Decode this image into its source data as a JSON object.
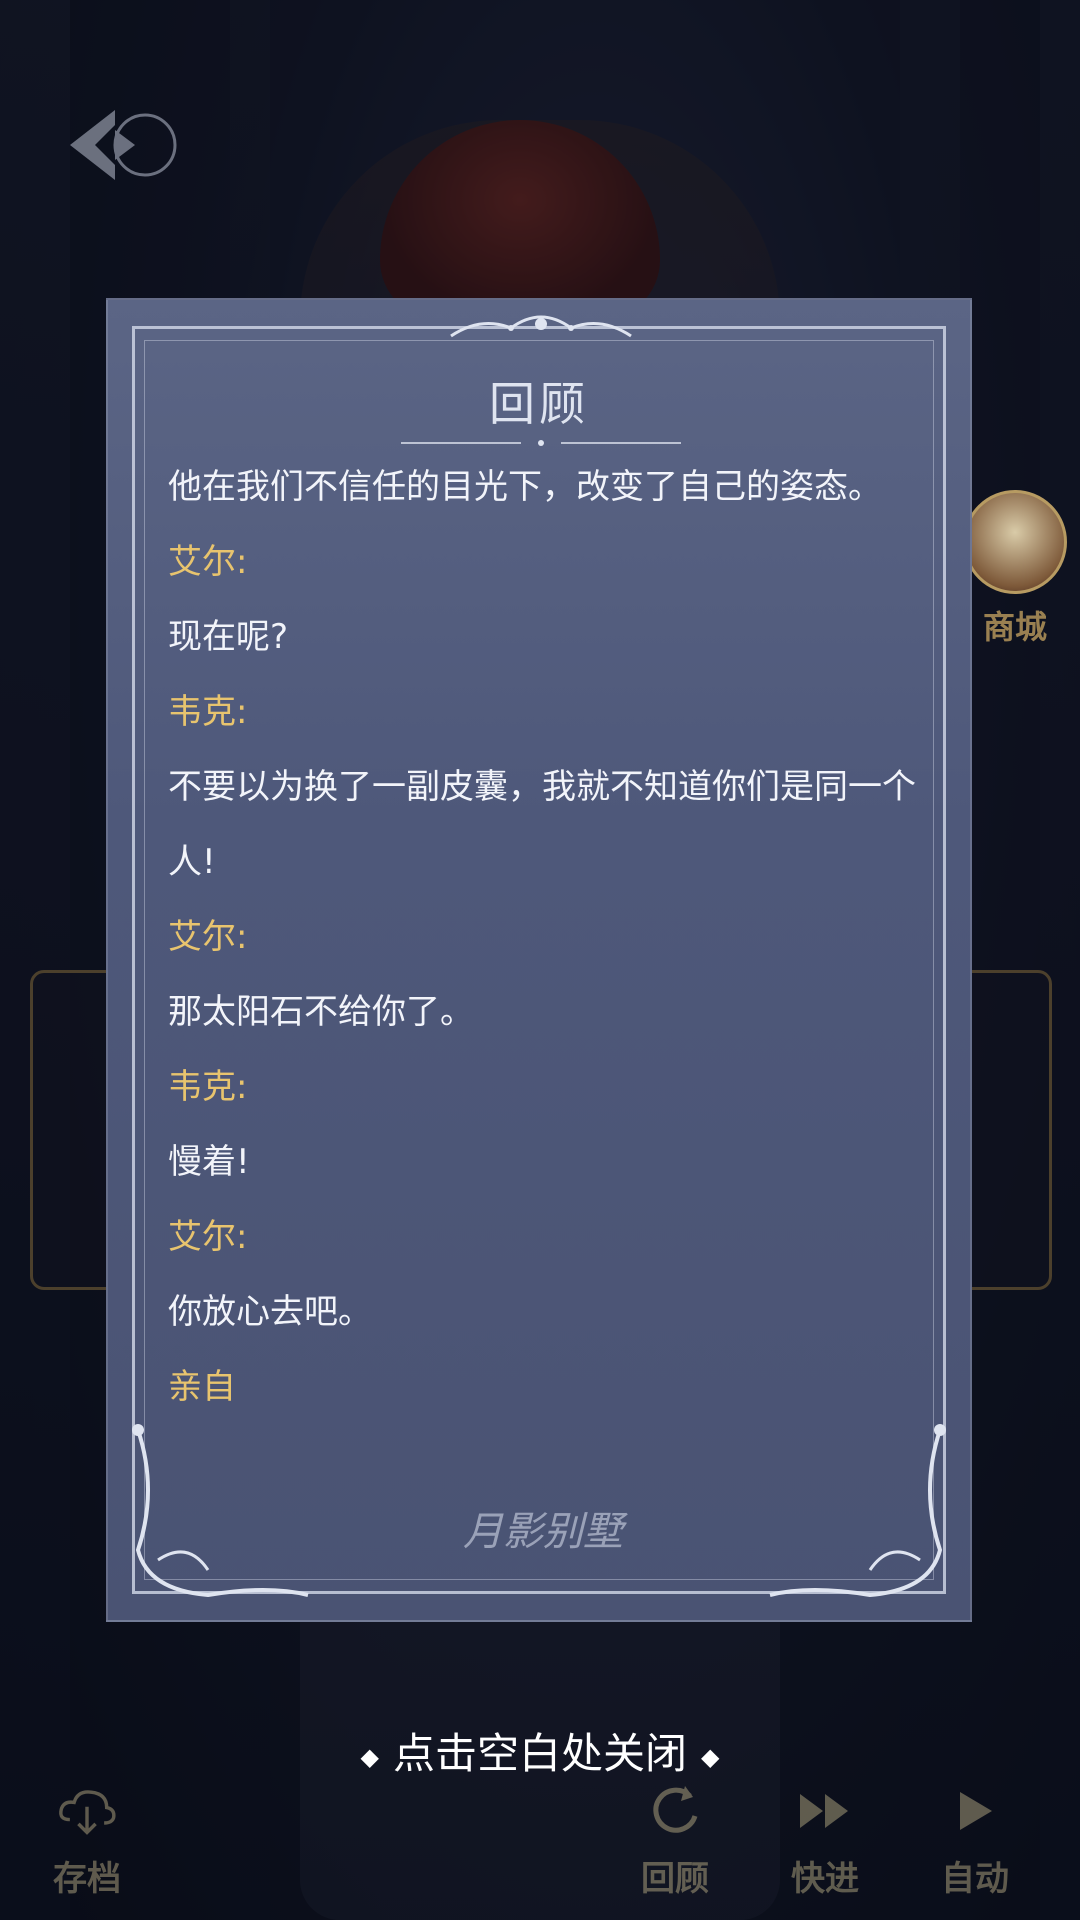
{
  "review": {
    "title": "回顾",
    "entries": [
      {
        "type": "text",
        "text": "他在我们不信任的目光下，改变了自己的姿态。"
      },
      {
        "type": "speaker",
        "text": "艾尔:"
      },
      {
        "type": "text",
        "text": "现在呢?"
      },
      {
        "type": "speaker",
        "text": "韦克:"
      },
      {
        "type": "text",
        "text": "不要以为换了一副皮囊，我就不知道你们是同一个人!"
      },
      {
        "type": "speaker",
        "text": "艾尔:"
      },
      {
        "type": "text",
        "text": "那太阳石不给你了。"
      },
      {
        "type": "speaker",
        "text": "韦克:"
      },
      {
        "type": "text",
        "text": "慢着!"
      },
      {
        "type": "speaker",
        "text": "艾尔:"
      },
      {
        "type": "text",
        "text": "你放心去吧。"
      },
      {
        "type": "speaker",
        "text": "亲自"
      }
    ],
    "watermark": "月影别墅"
  },
  "hint": {
    "close": "点击空白处关闭"
  },
  "store": {
    "label": "商城"
  },
  "toolbar": {
    "save": "存档",
    "review": "回顾",
    "skip": "快进",
    "auto": "自动"
  },
  "icons": {
    "back": "back-arrow-icon",
    "save": "cloud-save-icon",
    "review": "replay-icon",
    "skip": "fast-forward-icon",
    "auto": "play-icon"
  }
}
